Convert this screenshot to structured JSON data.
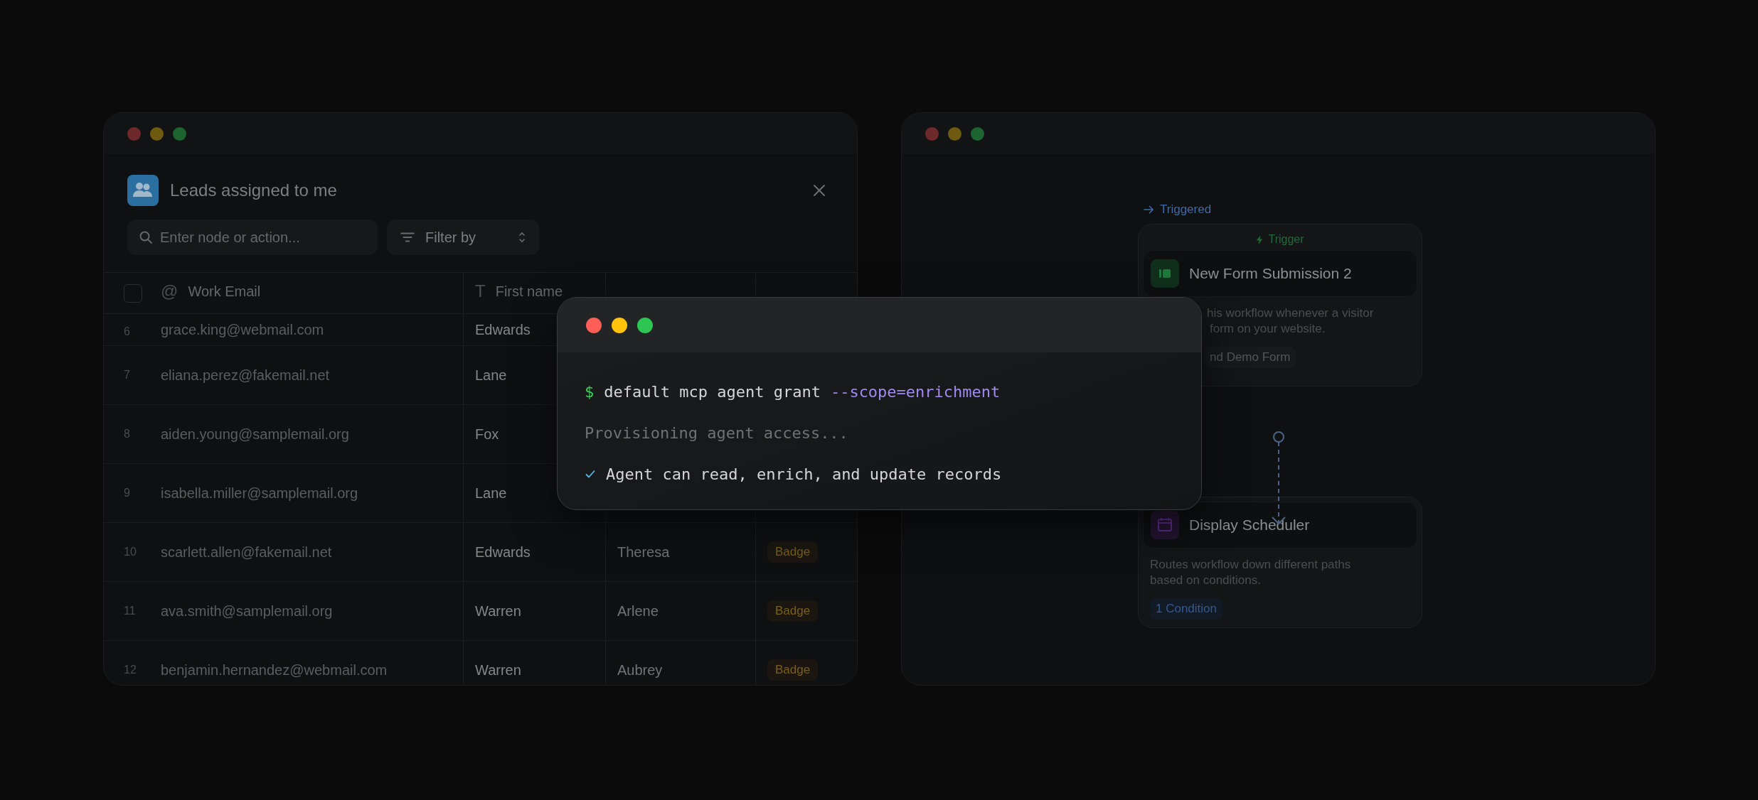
{
  "leads_window": {
    "title": "Leads assigned to me",
    "search": {
      "placeholder": "Enter node or action..."
    },
    "filter": {
      "label": "Filter by"
    },
    "table": {
      "header_checkbox": {
        "checked": false
      },
      "columns": [
        {
          "icon": "@",
          "label": "Work Email"
        },
        {
          "icon": "T",
          "label": "First name"
        }
      ],
      "rows": [
        {
          "number": "6",
          "email": "grace.king@webmail.com",
          "first_name": "Edwards"
        },
        {
          "number": "7",
          "email": "eliana.perez@fakemail.net",
          "first_name": "Lane"
        },
        {
          "number": "8",
          "email": "aiden.young@samplemail.org",
          "first_name": "Fox"
        },
        {
          "number": "9",
          "email": "isabella.miller@samplemail.org",
          "first_name": "Lane"
        },
        {
          "number": "10",
          "email": "scarlett.allen@fakemail.net",
          "first_name": "Edwards",
          "last_name": "Theresa",
          "status": "Badge"
        },
        {
          "number": "11",
          "email": "ava.smith@samplemail.org",
          "first_name": "Warren",
          "last_name": "Arlene",
          "status": "Badge"
        },
        {
          "number": "12",
          "email": "benjamin.hernandez@webmail.com",
          "first_name": "Warren",
          "last_name": "Aubrey",
          "status": "Badge"
        }
      ]
    }
  },
  "terminal": {
    "lines": [
      {
        "kind": "command",
        "prompt": "$",
        "command": "default mcp agent grant",
        "flag": "--scope=enrichment"
      },
      {
        "kind": "output",
        "text": "Provisioning agent access..."
      },
      {
        "kind": "success",
        "text": "Agent can read, enrich, and update records"
      }
    ]
  },
  "workflow_window": {
    "status": "Triggered",
    "nodes": [
      {
        "kind": "trigger",
        "header": "Trigger",
        "title": "New Form Submission 2",
        "description": [
          "his workflow whenever a visitor",
          "form on your website."
        ],
        "tag": "nd Demo Form"
      },
      {
        "kind": "scheduler",
        "title": "Display Scheduler",
        "description": [
          "Routes workflow down different paths",
          "based on conditions."
        ],
        "tag": "1 Condition"
      }
    ]
  }
}
